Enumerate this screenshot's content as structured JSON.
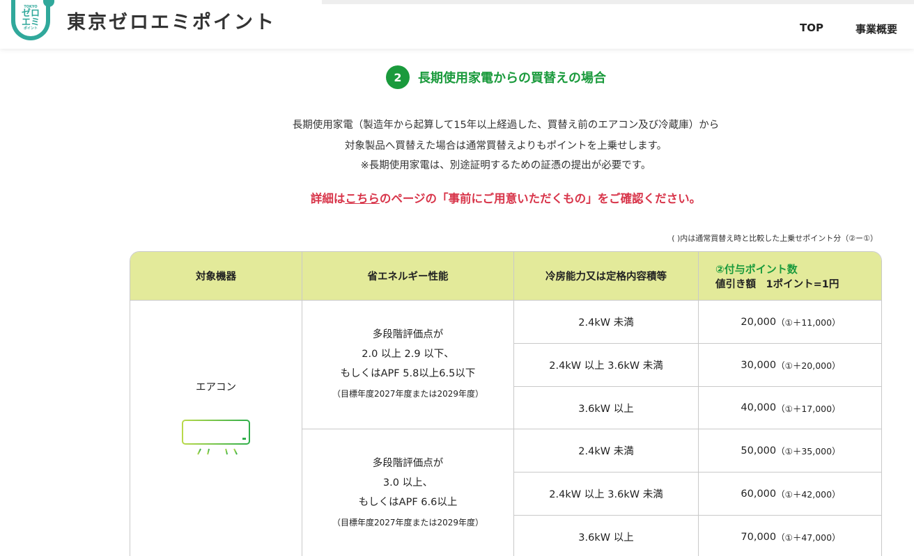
{
  "header": {
    "logo": {
      "small": "TOKYO",
      "line1": "ゼロ",
      "line2": "エミ",
      "line3": "ポイント"
    },
    "site_title": "東京ゼロエミポイント",
    "nav": {
      "top": "TOP",
      "about": "事業概要"
    }
  },
  "section": {
    "number": "2",
    "title": "長期使用家電からの買替えの場合",
    "desc_line1": "長期使用家電（製造年から起算して15年以上経過した、買替え前のエアコン及び冷蔵庫）から",
    "desc_line2": "対象製品へ買替えた場合は通常買替えよりもポイントを上乗せします。",
    "desc_line3": "※長期使用家電は、別途証明するための証憑の提出が必要です。",
    "notice_prefix": "詳細は",
    "notice_link": "こちら",
    "notice_suffix": "のページの「事前にご用意いただくもの」をご確認ください。",
    "table_note": "( )内は通常買替え時と比較した上乗せポイント分（②ー①）"
  },
  "table": {
    "headers": {
      "device": "対象機器",
      "performance": "省エネルギー性能",
      "capacity": "冷房能力又は定格内容積等",
      "points_line1": "②付与ポイント数",
      "points_line2": "値引き額　1ポイント=1円"
    },
    "device": "エアコン",
    "icon": "air-conditioner-icon",
    "groups": [
      {
        "perf_line1": "多段階評価点が",
        "perf_line2": "2.0 以上 2.9 以下、",
        "perf_line3": "もしくはAPF 5.8以上6.5以下",
        "perf_note": "（目標年度2027年度または2029年度）",
        "rows": [
          {
            "capacity": "2.4kW 未満",
            "points": "20,000",
            "diff": "（①＋11,000）"
          },
          {
            "capacity": "2.4kW 以上 3.6kW 未満",
            "points": "30,000",
            "diff": "（①＋20,000）"
          },
          {
            "capacity": "3.6kW 以上",
            "points": "40,000",
            "diff": "（①＋17,000）"
          }
        ]
      },
      {
        "perf_line1": "多段階評価点が",
        "perf_line2": "3.0 以上、",
        "perf_line3": "もしくはAPF 6.6以上",
        "perf_note": "（目標年度2027年度または2029年度）",
        "rows": [
          {
            "capacity": "2.4kW 未満",
            "points": "50,000",
            "diff": "（①＋35,000）"
          },
          {
            "capacity": "2.4kW 以上 3.6kW 未満",
            "points": "60,000",
            "diff": "（①＋42,000）"
          },
          {
            "capacity": "3.6kW 以上",
            "points": "70,000",
            "diff": "（①＋47,000）"
          }
        ]
      }
    ]
  },
  "colors": {
    "accent_green": "#1a9a3c",
    "notice_red": "#d8354a",
    "header_bg": "#e3ea9a",
    "logo_teal": "#30a89b"
  }
}
